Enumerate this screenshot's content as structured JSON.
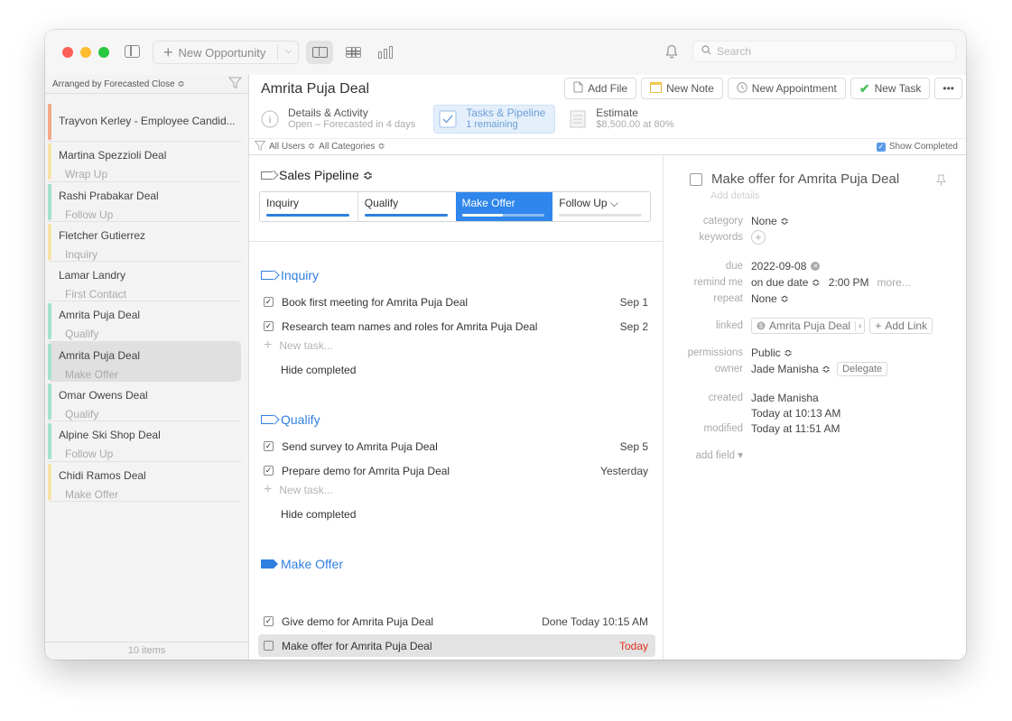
{
  "toolbar": {
    "new_opportunity": "New Opportunity",
    "search_placeholder": "Search"
  },
  "sidebar": {
    "sort_label": "Arranged by Forecasted Close ≎",
    "items": [
      {
        "name": "Trayvon Kerley - Employee Candid...",
        "stage": "",
        "color": "#f3a98a"
      },
      {
        "name": "Martina Spezzioli Deal",
        "stage": "Wrap Up",
        "color": "#f7e3a8"
      },
      {
        "name": "Rashi Prabakar Deal",
        "stage": "Follow Up",
        "color": "#a6e0cf"
      },
      {
        "name": "Fletcher Gutierrez",
        "stage": "Inquiry",
        "color": "#f7e3a8"
      },
      {
        "name": "Lamar Landry",
        "stage": "First Contact",
        "color": ""
      },
      {
        "name": "Amrita Puja Deal",
        "stage": "Qualify",
        "color": "#a6e0cf"
      },
      {
        "name": "Amrita Puja Deal",
        "stage": "Make Offer",
        "color": "#a6e0cf"
      },
      {
        "name": "Omar Owens Deal",
        "stage": "Qualify",
        "color": "#a6e0cf"
      },
      {
        "name": "Alpine Ski Shop Deal",
        "stage": "Follow Up",
        "color": "#a6e0cf"
      },
      {
        "name": "Chidi Ramos Deal",
        "stage": "Make Offer",
        "color": "#f7e3a8"
      }
    ],
    "footer": "10 items"
  },
  "header": {
    "title": "Amrita Puja Deal",
    "actions": {
      "add_file": "Add File",
      "new_note": "New Note",
      "new_appointment": "New Appointment",
      "new_task": "New Task",
      "more": "•••"
    },
    "tabs": [
      {
        "title": "Details & Activity",
        "subtitle": "Open – Forecasted in 4 days"
      },
      {
        "title": "Tasks & Pipeline",
        "subtitle": "1 remaining"
      },
      {
        "title": "Estimate",
        "subtitle": "$8,500.00 at 80%"
      }
    ]
  },
  "filters": {
    "users": "All Users ≎",
    "categories": "All Categories ≎",
    "show_completed": "Show Completed"
  },
  "pipeline": {
    "title": "Sales Pipeline ≎",
    "stages": [
      {
        "label": "Inquiry",
        "progress": 1.0
      },
      {
        "label": "Qualify",
        "progress": 1.0
      },
      {
        "label": "Make Offer",
        "progress": 0.5
      },
      {
        "label": "Follow Up ⌵",
        "progress": 0.0
      }
    ],
    "sections": {
      "inquiry": {
        "title": "Inquiry",
        "tasks": [
          {
            "label": "Book first meeting for Amrita Puja Deal",
            "date": "Sep 1"
          },
          {
            "label": "Research team names and roles for Amrita Puja Deal",
            "date": "Sep 2"
          }
        ]
      },
      "qualify": {
        "title": "Qualify",
        "tasks": [
          {
            "label": "Send survey to Amrita Puja Deal",
            "date": "Sep 5"
          },
          {
            "label": "Prepare demo for Amrita Puja Deal",
            "date": "Yesterday"
          }
        ]
      },
      "make_offer": {
        "title": "Make Offer",
        "tasks": [
          {
            "label": "Give demo for Amrita Puja Deal",
            "date": "Done Today 10:15 AM"
          },
          {
            "label": "Make offer for Amrita Puja Deal",
            "date": "Today"
          }
        ]
      }
    },
    "new_task_placeholder": "New task...",
    "hide_completed": "Hide completed"
  },
  "detail": {
    "title": "Make offer for Amrita Puja Deal",
    "add_details": "Add details",
    "category_label": "category",
    "category_value": "None ≎",
    "keywords_label": "keywords",
    "due_label": "due",
    "due_value": "2022-09-08",
    "remind_label": "remind me",
    "remind_value": "on due date ≎",
    "remind_time": "2:00 PM",
    "remind_more": "more...",
    "repeat_label": "repeat",
    "repeat_value": "None ≎",
    "linked_label": "linked",
    "linked_value": "Amrita Puja Deal",
    "add_link": "Add Link",
    "permissions_label": "permissions",
    "permissions_value": "Public ≎",
    "owner_label": "owner",
    "owner_value": "Jade Manisha ≎",
    "delegate": "Delegate",
    "created_label": "created",
    "created_by": "Jade Manisha",
    "created_time": "Today at 10:13 AM",
    "modified_label": "modified",
    "modified_time": "Today at 11:51 AM",
    "add_field": "add field ▾"
  },
  "colors": {
    "accent": "#2f86ec",
    "overdue": "#e0301e"
  }
}
